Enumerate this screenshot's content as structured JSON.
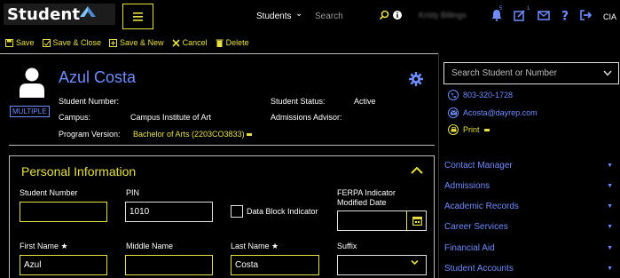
{
  "brand": {
    "name": "Student"
  },
  "header": {
    "search_scope": "Students",
    "search_placeholder": "Search",
    "user_name": "Kristy Billings",
    "initials": "CIA",
    "notification_count": "5",
    "task_count": "1"
  },
  "toolbar": {
    "save": "Save",
    "save_close": "Save & Close",
    "save_new": "Save & New",
    "cancel": "Cancel",
    "delete": "Delete"
  },
  "student": {
    "name": "Azul Costa",
    "multiple_badge": "MULTIPLE",
    "student_number_label": "Student Number:",
    "student_number": "",
    "campus_label": "Campus:",
    "campus": "Campus Institute of Art",
    "program_label": "Program Version:",
    "program": "Bachelor of Arts (2203CO3833)",
    "status_label": "Student Status:",
    "status": "Active",
    "advisor_label": "Admissions Advisor:",
    "advisor": ""
  },
  "personal": {
    "title": "Personal Information",
    "student_number_label": "Student Number",
    "student_number_value": "",
    "pin_label": "PIN",
    "pin_value": "1010",
    "data_block_label": "Data Block Indicator",
    "ferpa_label_1": "FERPA Indicator",
    "ferpa_label_2": "Modified Date",
    "ferpa_value": "",
    "first_name_label": "First Name",
    "first_name_value": "Azul",
    "middle_name_label": "Middle Name",
    "middle_name_value": "",
    "last_name_label": "Last Name",
    "last_name_value": "Costa",
    "suffix_label": "Suffix",
    "suffix_value": "",
    "required_mark": "★"
  },
  "sidebar": {
    "search_placeholder": "Search Student or Number",
    "phone": "803-320-1728",
    "email": "Acosta@dayrep.com",
    "print": "Print",
    "nav": [
      {
        "label": "Contact Manager"
      },
      {
        "label": "Admissions"
      },
      {
        "label": "Academic Records"
      },
      {
        "label": "Career Services"
      },
      {
        "label": "Financial Aid"
      },
      {
        "label": "Student Accounts"
      }
    ]
  },
  "colors": {
    "accent_yellow": "#e6e043",
    "accent_blue": "#6f8cff",
    "background": "#000000"
  }
}
